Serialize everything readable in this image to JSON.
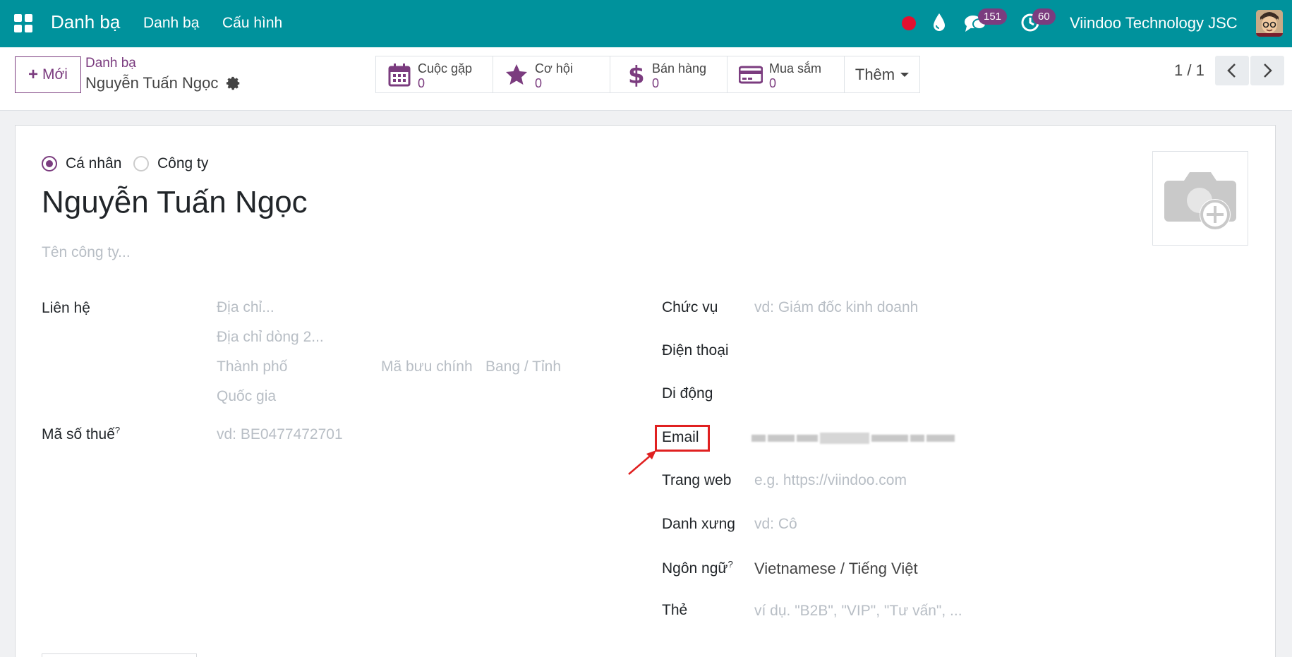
{
  "navbar": {
    "app_name": "Danh bạ",
    "menu": [
      "Danh bạ",
      "Cấu hình"
    ],
    "messages_count": "151",
    "activities_count": "60",
    "company": "Viindoo Technology JSC"
  },
  "control_panel": {
    "new_button": "Mới",
    "breadcrumb_parent": "Danh bạ",
    "breadcrumb_current": "Nguyễn Tuấn Ngọc",
    "stat_buttons": [
      {
        "label": "Cuộc gặp",
        "value": "0",
        "icon": "calendar-icon"
      },
      {
        "label": "Cơ hội",
        "value": "0",
        "icon": "star-icon"
      },
      {
        "label": "Bán hàng",
        "value": "0",
        "icon": "dollar-icon"
      },
      {
        "label": "Mua sắm",
        "value": "0",
        "icon": "credit-card-icon"
      }
    ],
    "more_button": "Thêm",
    "pager": "1 / 1"
  },
  "form": {
    "type_individual": "Cá nhân",
    "type_company": "Công ty",
    "selected_type": "Cá nhân",
    "name": "Nguyễn Tuấn Ngọc",
    "company_placeholder": "Tên công ty...",
    "contact_label": "Liên hệ",
    "address_placeholder": "Địa chỉ...",
    "address2_placeholder": "Địa chỉ dòng 2...",
    "city_placeholder": "Thành phố",
    "zip_placeholder": "Mã bưu chính",
    "state_placeholder": "Bang / Tỉnh",
    "country_placeholder": "Quốc gia",
    "tax_label": "Mã số thuế",
    "tax_placeholder": "vd: BE0477472701",
    "job_label": "Chức vụ",
    "job_placeholder": "vd: Giám đốc kinh doanh",
    "phone_label": "Điện thoại",
    "mobile_label": "Di động",
    "email_label": "Email",
    "website_label": "Trang web",
    "website_placeholder": "e.g. https://viindoo.com",
    "title_label": "Danh xưng",
    "title_placeholder": "vd: Cô",
    "language_label": "Ngôn ngữ",
    "language_value": "Vietnamese / Tiếng Việt",
    "tags_label": "Thẻ",
    "tags_placeholder": "ví dụ. \"B2B\", \"VIP\", \"Tư vấn\", ..."
  },
  "colors": {
    "navbar": "#00929c",
    "primary": "#7b3c7f",
    "highlight": "#e02020"
  }
}
